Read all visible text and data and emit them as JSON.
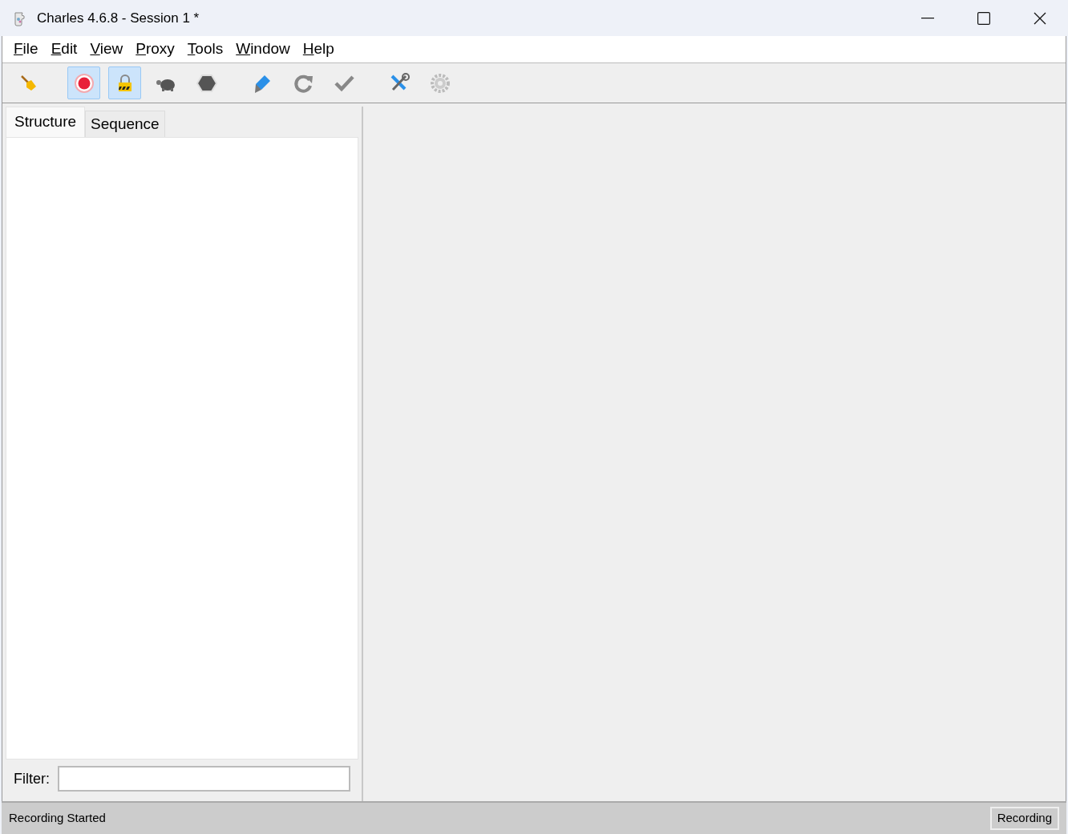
{
  "window": {
    "title": "Charles 4.6.8 - Session 1 *"
  },
  "menu": [
    {
      "label": "File"
    },
    {
      "label": "Edit"
    },
    {
      "label": "View"
    },
    {
      "label": "Proxy"
    },
    {
      "label": "Tools"
    },
    {
      "label": "Window"
    },
    {
      "label": "Help"
    }
  ],
  "toolbar": [
    {
      "tools": [
        {
          "kind": "broom",
          "pressed": false
        }
      ]
    },
    {
      "tools": [
        {
          "kind": "record",
          "pressed": true
        },
        {
          "kind": "lock",
          "pressed": true
        },
        {
          "kind": "turtle",
          "pressed": false
        },
        {
          "kind": "hexagon",
          "pressed": false
        }
      ]
    },
    {
      "tools": [
        {
          "kind": "pen",
          "pressed": false
        },
        {
          "kind": "refresh",
          "pressed": false
        },
        {
          "kind": "check",
          "pressed": false
        }
      ]
    },
    {
      "tools": [
        {
          "kind": "tools",
          "pressed": false
        },
        {
          "kind": "gear",
          "pressed": false
        }
      ]
    }
  ],
  "tabs": [
    {
      "label": "Structure",
      "selected": true
    },
    {
      "label": "Sequence",
      "selected": false
    }
  ],
  "filter": {
    "label": "Filter:"
  },
  "status_bar": {
    "message": "Recording Started",
    "state": "Recording"
  }
}
